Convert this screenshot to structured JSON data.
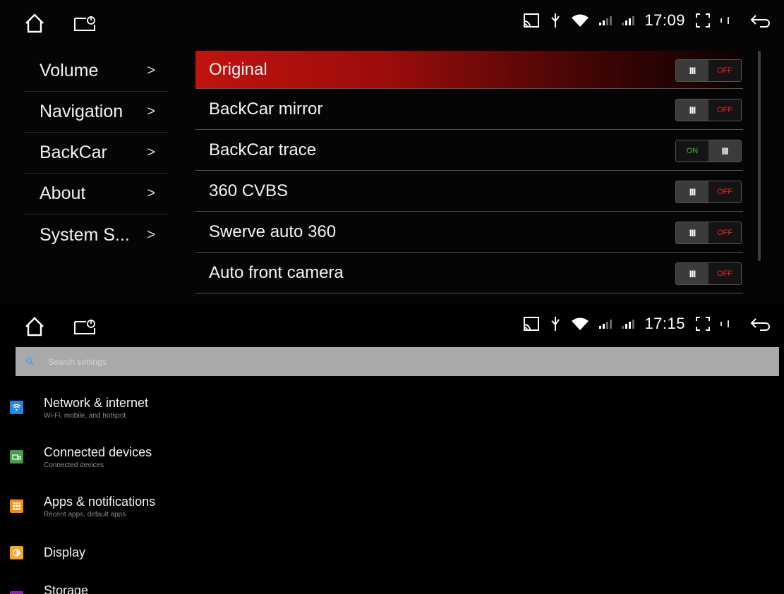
{
  "screen1": {
    "status": {
      "time": "17:09"
    },
    "menu": [
      {
        "label": "Volume",
        "chevron": ">"
      },
      {
        "label": "Navigation",
        "chevron": ">"
      },
      {
        "label": "BackCar",
        "chevron": ">"
      },
      {
        "label": "About",
        "chevron": ">"
      },
      {
        "label": "System S...",
        "chevron": ">"
      }
    ],
    "rows": [
      {
        "label": "Original",
        "state": "OFF",
        "highlighted": true
      },
      {
        "label": "BackCar mirror",
        "state": "OFF"
      },
      {
        "label": "BackCar trace",
        "state": "ON"
      },
      {
        "label": "360 CVBS",
        "state": "OFF"
      },
      {
        "label": "Swerve auto 360",
        "state": "OFF"
      },
      {
        "label": "Auto front camera",
        "state": "OFF"
      }
    ],
    "toggle_knob": "III",
    "colors": {
      "accent": "#c2120e",
      "on": "#2fbf3a",
      "off": "#e0281c"
    }
  },
  "screen2": {
    "status": {
      "time": "17:15"
    },
    "search": {
      "placeholder": "Search settings"
    },
    "settings": [
      {
        "title": "Network & internet",
        "subtitle": "Wi-Fi, mobile, and hotspot",
        "icon": "wifi-icon",
        "color": "#1e88e5"
      },
      {
        "title": "Connected devices",
        "subtitle": "Connected devices",
        "icon": "devices-icon",
        "color": "#43a047"
      },
      {
        "title": "Apps & notifications",
        "subtitle": "Recent apps, default apps",
        "icon": "apps-icon",
        "color": "#fb8c00"
      },
      {
        "title": "Display",
        "subtitle": "",
        "icon": "display-icon",
        "color": "#f9a825"
      },
      {
        "title": "Storage",
        "subtitle": "",
        "icon": "storage-icon",
        "color": "#8e24aa"
      }
    ]
  }
}
